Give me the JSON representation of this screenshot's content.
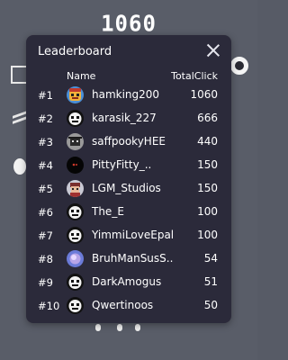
{
  "background": {
    "score": "1060"
  },
  "leaderboard": {
    "title": "Leaderboard",
    "columns": {
      "name": "Name",
      "total": "TotalClick"
    },
    "rows": [
      {
        "rank": "#1",
        "name": "hamking200",
        "clicks": "1060",
        "avatar": "cartoon-face-avatar"
      },
      {
        "rank": "#2",
        "name": "karasik_227",
        "clicks": "666",
        "avatar": "default-robot-avatar"
      },
      {
        "rank": "#3",
        "name": "saffpookyHEE",
        "clicks": "440",
        "avatar": "grey-hat-avatar"
      },
      {
        "rank": "#4",
        "name": "PittyFitty_..",
        "clicks": "150",
        "avatar": "dark-avatar"
      },
      {
        "rank": "#5",
        "name": "LGM_Studios",
        "clicks": "150",
        "avatar": "pixel-character-avatar"
      },
      {
        "rank": "#6",
        "name": "The_E",
        "clicks": "100",
        "avatar": "default-robot-avatar"
      },
      {
        "rank": "#7",
        "name": "YimmiLoveEpal",
        "clicks": "100",
        "avatar": "default-robot-avatar"
      },
      {
        "rank": "#8",
        "name": "BruhManSusS..",
        "clicks": "54",
        "avatar": "purple-blob-avatar"
      },
      {
        "rank": "#9",
        "name": "DarkAmogus",
        "clicks": "51",
        "avatar": "default-robot-avatar"
      },
      {
        "rank": "#10",
        "name": "Qwertinoos",
        "clicks": "50",
        "avatar": "default-robot-avatar"
      }
    ]
  },
  "colors": {
    "page_background": "#595d68",
    "modal_background": "#2b2a3a",
    "text": "#ffffff"
  }
}
